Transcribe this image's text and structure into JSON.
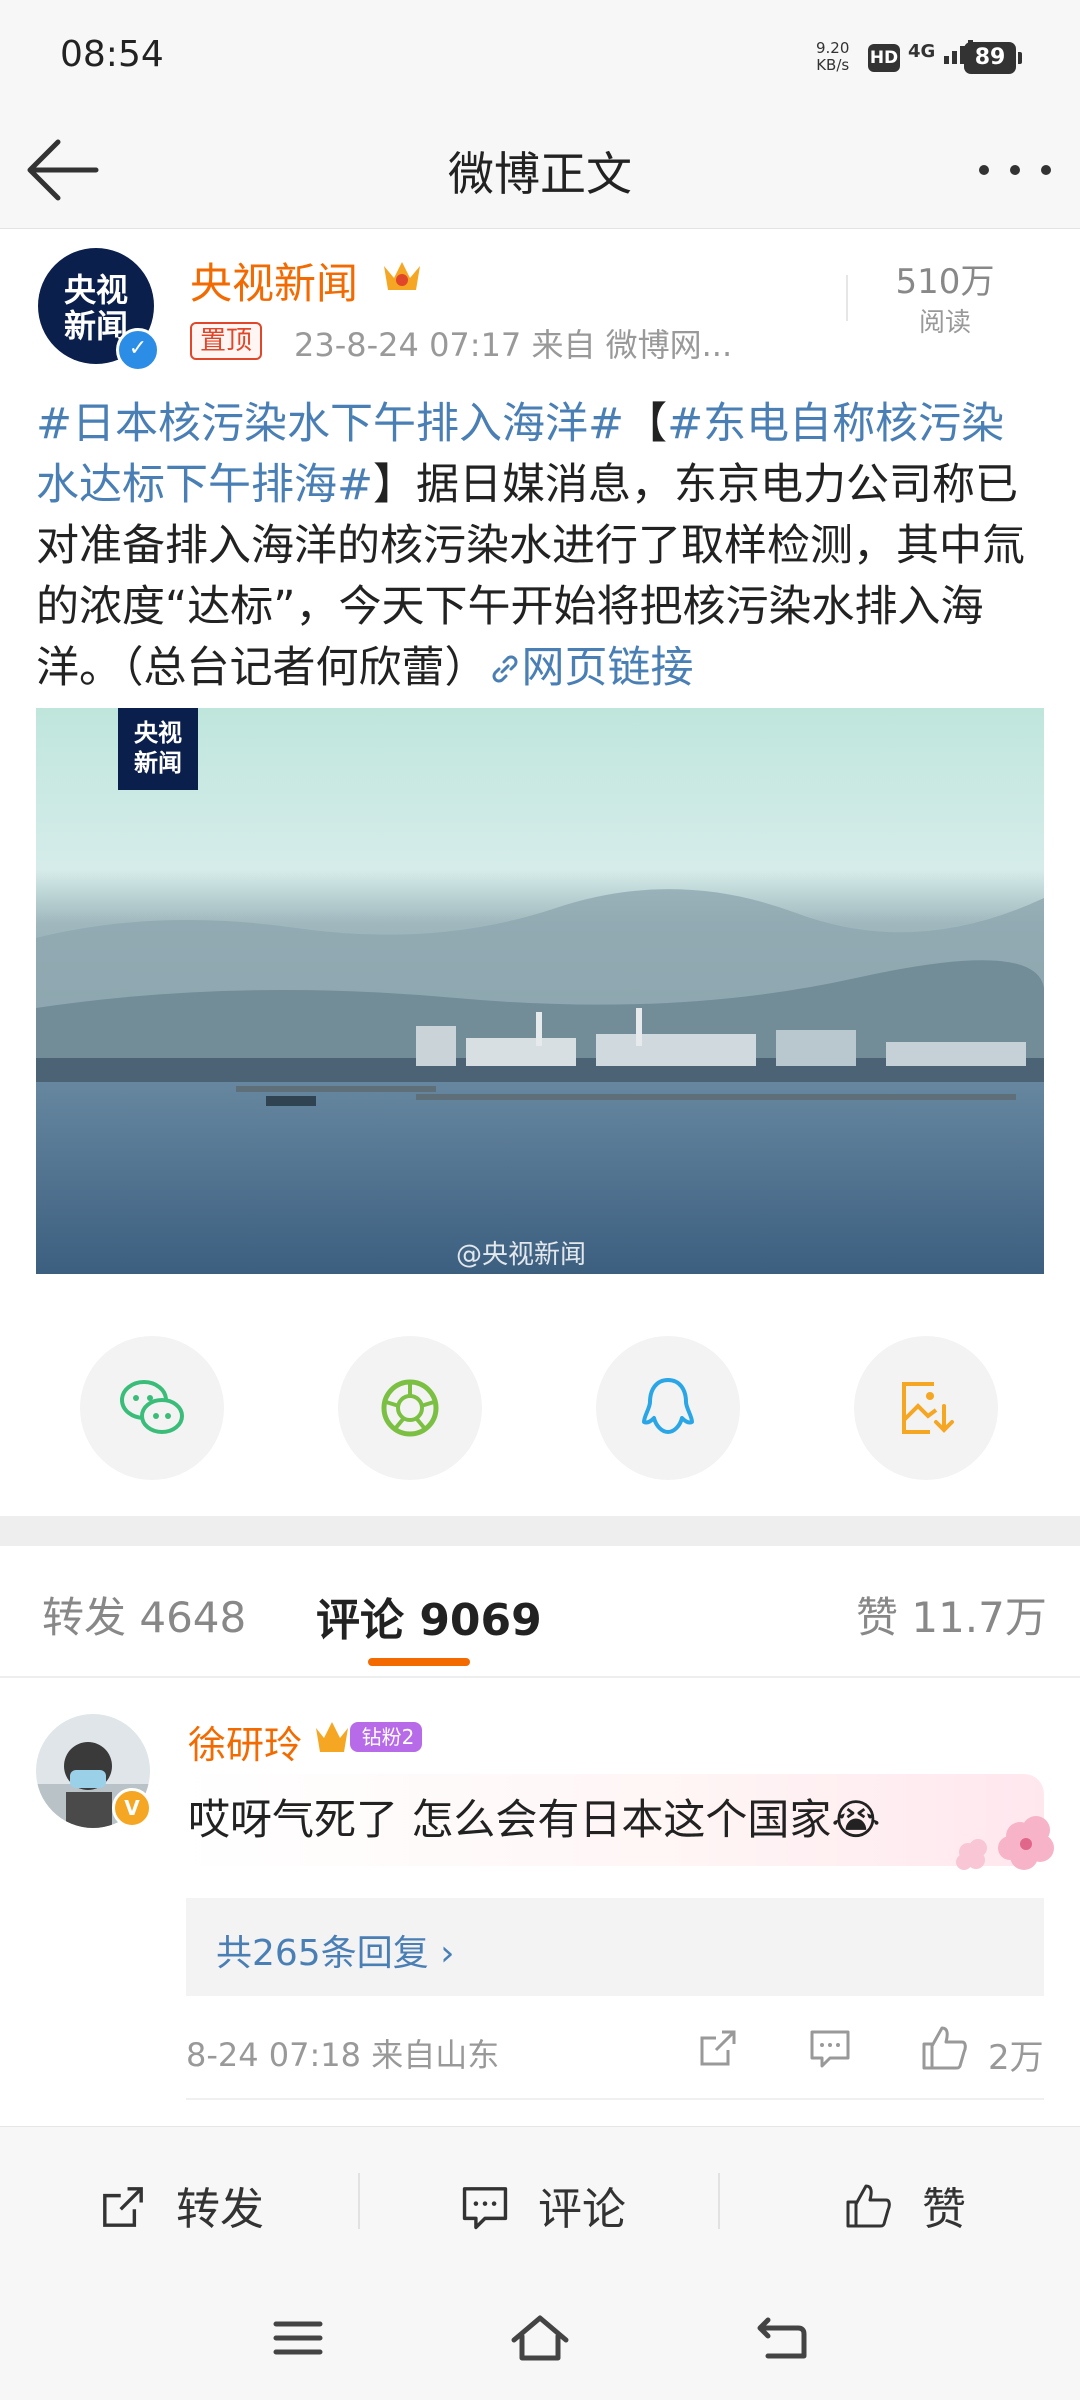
{
  "status_bar": {
    "time": "08:54",
    "speed_value": "9.20",
    "speed_unit": "KB/s",
    "hd": "HD",
    "network": "4G",
    "battery": "89"
  },
  "nav": {
    "title": "微博正文"
  },
  "post": {
    "author": "央视新闻",
    "avatar_text_line1": "央视",
    "avatar_text_line2": "新闻",
    "pin_label": "置顶",
    "meta": "23-8-24 07:17  来自 微博网...",
    "read_count": "510万",
    "read_label": "阅读",
    "text_topic1": "#日本核污染水下午排入海洋#",
    "text_bracket_open": "【",
    "text_topic2": "#东电自称核污染水达标下午排海#",
    "text_body": "】据日媒消息，东京电力公司称已对准备排入海洋的核污染水进行了取样检测，其中氚的浓度“达标”，今天下午开始将把核污染水排入海洋。（总台记者何欣蕾）",
    "link_label": "网页链接",
    "image_logo_line1": "央视",
    "image_logo_line2": "新闻",
    "image_watermark": "@央视新闻"
  },
  "share_icons": [
    "wechat-icon",
    "moments-icon",
    "qq-icon",
    "save-image-icon"
  ],
  "tabs": {
    "repost": "转发 4648",
    "comment": "评论 9069",
    "like": "赞 11.7万"
  },
  "comment": {
    "user": "徐研玲",
    "fan_badge": "钻粉2",
    "text": "哎呀气死了 怎么会有日本这个国家😭",
    "replies_link": "共265条回复 ›",
    "meta": "8-24 07:18  来自山东",
    "like_count": "2万"
  },
  "action_bar": {
    "repost": "转发",
    "comment": "评论",
    "like": "赞"
  },
  "colors": {
    "accent_orange": "#f26a00",
    "link_blue": "#4a7fb5"
  }
}
